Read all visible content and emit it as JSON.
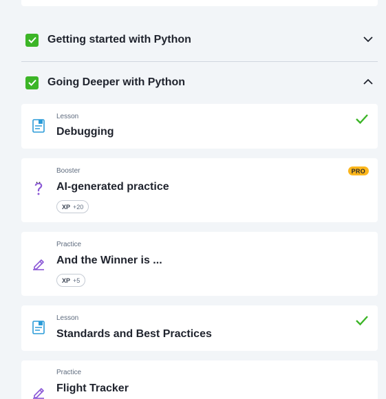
{
  "sections": [
    {
      "title": "Getting started with Python",
      "expanded": false
    },
    {
      "title": "Going Deeper with Python",
      "expanded": true
    }
  ],
  "items": [
    {
      "kind": "Lesson",
      "title": "Debugging",
      "icon": "lesson-icon",
      "completed": true
    },
    {
      "kind": "Booster",
      "title": "AI-generated practice",
      "icon": "booster-icon",
      "badge": "PRO",
      "xp_label": "XP",
      "xp_value": "+20"
    },
    {
      "kind": "Practice",
      "title": "And the Winner is ...",
      "icon": "practice-icon",
      "xp_label": "XP",
      "xp_value": "+5"
    },
    {
      "kind": "Lesson",
      "title": "Standards and Best Practices",
      "icon": "lesson-icon",
      "completed": true
    },
    {
      "kind": "Practice",
      "title": "Flight Tracker",
      "icon": "practice-icon"
    }
  ],
  "colors": {
    "background": "#f2f5f8",
    "check_green": "#3cb527",
    "lesson_blue": "#2a9bd8",
    "practice_purple": "#8a57d6",
    "pro_yellow": "#fcb61c"
  }
}
